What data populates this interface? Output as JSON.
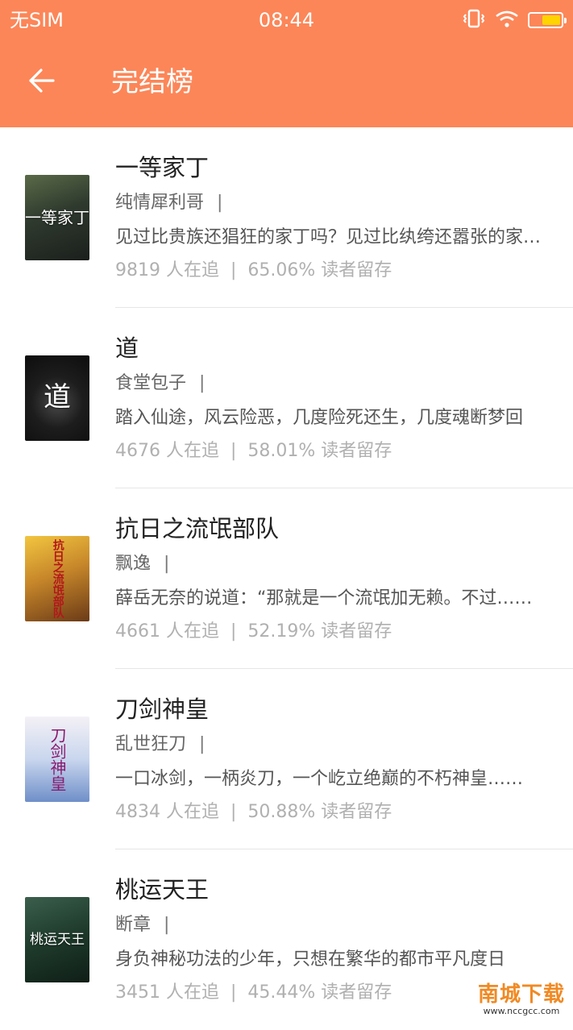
{
  "status_bar": {
    "carrier": "无SIM",
    "time": "08:44",
    "vibrate_icon": "vibrate-icon",
    "wifi_icon": "wifi-icon",
    "battery_level": 0.6,
    "battery_color": "#ffd400"
  },
  "header": {
    "back_icon": "back-arrow-icon",
    "title": "完结榜",
    "background_color": "#fc8658"
  },
  "books": [
    {
      "title": "一等家丁",
      "author": "纯情犀利哥",
      "author_sep": "|",
      "description": "见过比贵族还猖狂的家丁吗？见过比纨绔还嚣张的家丁吗？",
      "followers": "9819 人在追",
      "stats_sep": "|",
      "retention": "65.06% 读者留存",
      "cover_text": "一等家丁"
    },
    {
      "title": "道",
      "author": "食堂包子",
      "author_sep": "|",
      "description": "踏入仙途，风云险恶，几度险死还生，几度魂断梦回",
      "followers": "4676 人在追",
      "stats_sep": "|",
      "retention": "58.01% 读者留存",
      "cover_text": "道"
    },
    {
      "title": "抗日之流氓部队",
      "author": "飘逸",
      "author_sep": "|",
      "description": "薛岳无奈的说道：“那就是一个流氓加无赖。不过……",
      "followers": "4661 人在追",
      "stats_sep": "|",
      "retention": "52.19% 读者留存",
      "cover_text": "抗日之流氓部队"
    },
    {
      "title": "刀剑神皇",
      "author": "乱世狂刀",
      "author_sep": "|",
      "description": "一口冰剑，一柄炎刀，一个屹立绝巅的不朽神皇……",
      "followers": "4834 人在追",
      "stats_sep": "|",
      "retention": "50.88% 读者留存",
      "cover_text": "刀剑神皇"
    },
    {
      "title": "桃运天王",
      "author": "断章",
      "author_sep": "|",
      "description": "身负神秘功法的少年，只想在繁华的都市平凡度日",
      "followers": "3451 人在追",
      "stats_sep": "|",
      "retention": "45.44% 读者留存",
      "cover_text": "桃运天王"
    }
  ],
  "watermark": {
    "main": "南城下载",
    "sub": "www.nccgcc.com"
  }
}
